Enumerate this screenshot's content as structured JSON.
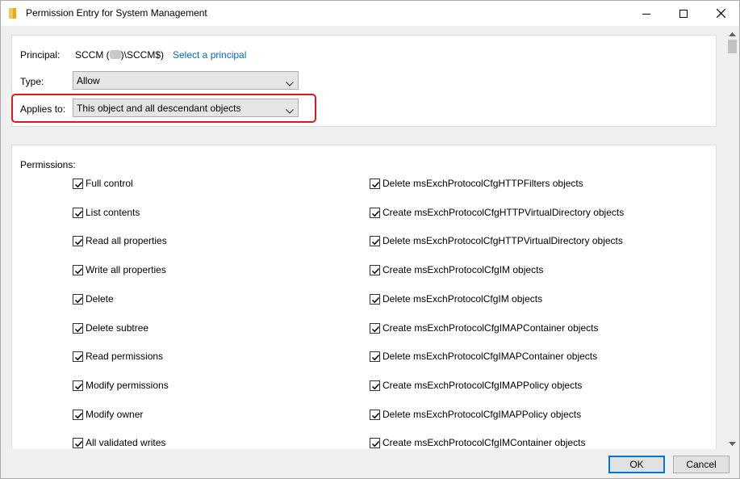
{
  "window": {
    "title": "Permission Entry for System Management",
    "icon": "folder-icon",
    "minimize_icon": "minimize-icon",
    "maximize_icon": "maximize-icon",
    "close_icon": "close-icon"
  },
  "principal": {
    "label": "Principal:",
    "value_prefix": "SCCM (",
    "value_suffix": ")\\SCCM$)",
    "select_link": "Select a principal"
  },
  "type": {
    "label": "Type:",
    "value": "Allow"
  },
  "applies_to": {
    "label": "Applies to:",
    "value": "This object and all descendant objects",
    "highlight_color": "#e01a1a"
  },
  "permissions": {
    "label": "Permissions:",
    "left": [
      {
        "label": "Full control",
        "checked": true
      },
      {
        "label": "List contents",
        "checked": true
      },
      {
        "label": "Read all properties",
        "checked": true
      },
      {
        "label": "Write all properties",
        "checked": true
      },
      {
        "label": "Delete",
        "checked": true
      },
      {
        "label": "Delete subtree",
        "checked": true
      },
      {
        "label": "Read permissions",
        "checked": true
      },
      {
        "label": "Modify permissions",
        "checked": true
      },
      {
        "label": "Modify owner",
        "checked": true
      },
      {
        "label": "All validated writes",
        "checked": true
      }
    ],
    "right": [
      {
        "label": "Delete msExchProtocolCfgHTTPFilters objects",
        "checked": true
      },
      {
        "label": "Create msExchProtocolCfgHTTPVirtualDirectory objects",
        "checked": true
      },
      {
        "label": "Delete msExchProtocolCfgHTTPVirtualDirectory objects",
        "checked": true
      },
      {
        "label": "Create msExchProtocolCfgIM objects",
        "checked": true
      },
      {
        "label": "Delete msExchProtocolCfgIM objects",
        "checked": true
      },
      {
        "label": "Create msExchProtocolCfgIMAPContainer objects",
        "checked": true
      },
      {
        "label": "Delete msExchProtocolCfgIMAPContainer objects",
        "checked": true
      },
      {
        "label": "Create msExchProtocolCfgIMAPPolicy objects",
        "checked": true
      },
      {
        "label": "Delete msExchProtocolCfgIMAPPolicy objects",
        "checked": true
      },
      {
        "label": "Create msExchProtocolCfgIMContainer objects",
        "checked": true
      }
    ]
  },
  "footer": {
    "ok_label": "OK",
    "cancel_label": "Cancel"
  }
}
